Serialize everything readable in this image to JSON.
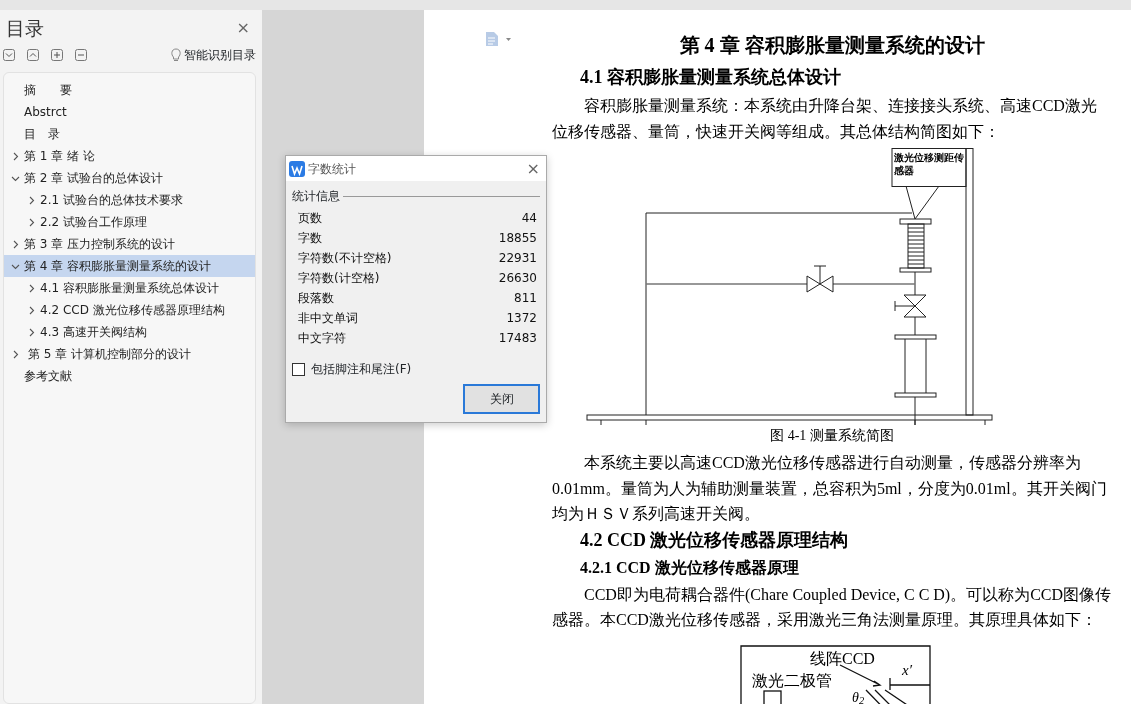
{
  "sidebar": {
    "title": "目录",
    "close": "×",
    "smart_button": "智能识别目录",
    "tree": [
      {
        "label": "摘　　要",
        "kind": "leaf",
        "selected": false
      },
      {
        "label": "Abstrct",
        "kind": "leaf",
        "selected": false
      },
      {
        "label": "目　录",
        "kind": "leaf",
        "selected": false
      },
      {
        "label": "第 1 章 绪 论",
        "kind": "branch",
        "expanded": false,
        "selected": false
      },
      {
        "label": "第 2 章 试验台的总体设计",
        "kind": "branch",
        "expanded": true,
        "selected": false,
        "children": [
          {
            "label": "2.1 试验台的总体技术要求",
            "kind": "branch",
            "expanded": false,
            "selected": false
          },
          {
            "label": "2.2 试验台工作原理",
            "kind": "branch",
            "expanded": false,
            "selected": false
          }
        ]
      },
      {
        "label": "第 3 章 压力控制系统的设计",
        "kind": "branch",
        "expanded": false,
        "selected": false
      },
      {
        "label": "第 4 章 容积膨胀量测量系统的设计",
        "kind": "branch",
        "expanded": true,
        "selected": true,
        "children": [
          {
            "label": "4.1 容积膨胀量测量系统总体设计",
            "kind": "branch",
            "expanded": false,
            "selected": false
          },
          {
            "label": "4.2 CCD 激光位移传感器原理结构",
            "kind": "branch",
            "expanded": false,
            "selected": false
          },
          {
            "label": "4.3 高速开关阀结构",
            "kind": "branch",
            "expanded": false,
            "selected": false
          }
        ]
      },
      {
        "label": " 第 5 章 计算机控制部分的设计",
        "kind": "branch",
        "expanded": false,
        "selected": false
      },
      {
        "label": "参考文献",
        "kind": "leaf",
        "selected": false
      }
    ]
  },
  "dialog": {
    "title": "字数统计",
    "close": "×",
    "group": "统计信息",
    "stats": [
      {
        "label": "页数",
        "value": "44"
      },
      {
        "label": "字数",
        "value": "18855"
      },
      {
        "label": "字符数(不计空格)",
        "value": "22931"
      },
      {
        "label": "字符数(计空格)",
        "value": "26630"
      },
      {
        "label": "段落数",
        "value": "811"
      },
      {
        "label": "非中文单词",
        "value": "1372"
      },
      {
        "label": "中文字符",
        "value": "17483"
      }
    ],
    "checkbox": {
      "label": "包括脚注和尾注(F)",
      "checked": false
    },
    "button": "关闭"
  },
  "document": {
    "blocks": [
      {
        "kind": "h1",
        "text": "第 4 章  容积膨胀量测量系统的设计"
      },
      {
        "kind": "h2",
        "text": "4.1  容积膨胀量测量系统总体设计"
      },
      {
        "kind": "p",
        "text": "容积膨胀量测量系统：本系统由升降台架、连接接头系统、高速CCD激光位移传感器、量筒，快速开关阀等组成。其总体结构简图如下："
      },
      {
        "kind": "figure1",
        "labels": [
          "激光位移测距传感器"
        ]
      },
      {
        "kind": "caption",
        "text": "图 4-1  测量系统简图"
      },
      {
        "kind": "p",
        "text": "本系统主要以高速CCD激光位移传感器进行自动测量，传感器分辨率为0.01mm。量筒为人为辅助测量装置，总容积为5ml，分度为0.01ml。其开关阀门均为ＨＳＶ系列高速开关阀。"
      },
      {
        "kind": "h2",
        "text": "4.2 CCD 激光位移传感器原理结构"
      },
      {
        "kind": "h3",
        "text": "4.2.1 CCD 激光位移传感器原理"
      },
      {
        "kind": "p",
        "text": "CCD即为电荷耦合器件(Chare Coupled Device, C C D)。可以称为CCD图像传感器。本CCD激光位移传感器，采用激光三角法测量原理。其原理具体如下："
      },
      {
        "kind": "figure2",
        "labels": [
          "线阵CCD",
          "激光二极管",
          "x′",
          "θ$_{2}$"
        ]
      }
    ]
  }
}
